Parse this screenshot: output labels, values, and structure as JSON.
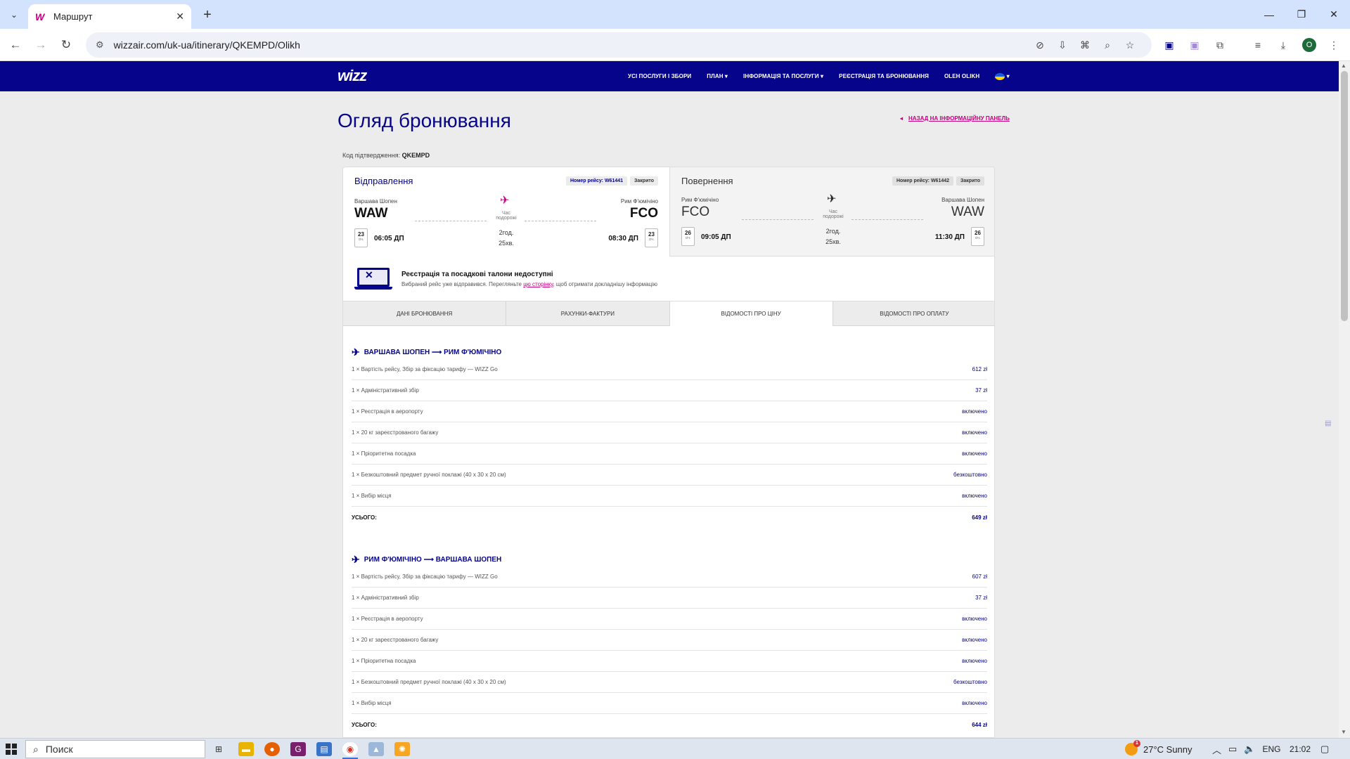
{
  "browser": {
    "tab_title": "Маршрут",
    "url": "wizzair.com/uk-ua/itinerary/QKEMPD/Olikh",
    "profile_initial": "O"
  },
  "site": {
    "logo": "wizz",
    "nav": [
      "УСІ ПОСЛУГИ І ЗБОРИ",
      "ПЛАН",
      "ІНФОРМАЦІЯ ТА ПОСЛУГИ",
      "РЕЄСТРАЦІЯ ТА БРОНЮВАННЯ",
      "OLEH OLIKH"
    ],
    "page_title": "Огляд бронювання",
    "back_link": "НАЗАД НА ІНФОРМАЦІЙНУ ПАНЕЛЬ",
    "confirmation_label": "Код підтвердження:",
    "confirmation_code": "QKEMPD"
  },
  "outbound": {
    "title": "Відправлення",
    "flight_no": "Номер рейсу: W61441",
    "status": "Закрито",
    "from_city": "Варшава Шопен",
    "from_code": "WAW",
    "to_city": "Рим Ф'юмічіно",
    "to_code": "FCO",
    "dep_day": "23",
    "dep_month": "січ.",
    "dep_time": "06:05 ДП",
    "arr_day": "23",
    "arr_month": "січ.",
    "arr_time": "08:30 ДП",
    "duration_label": "Час подорожі",
    "duration_h": "2год.",
    "duration_m": "25хв."
  },
  "return": {
    "title": "Повернення",
    "flight_no": "Номер рейсу: W61442",
    "status": "Закрито",
    "from_city": "Рим Ф'юмічіно",
    "from_code": "FCO",
    "to_city": "Варшава Шопен",
    "to_code": "WAW",
    "dep_day": "26",
    "dep_month": "січ.",
    "dep_time": "09:05 ДП",
    "arr_day": "26",
    "arr_month": "січ.",
    "arr_time": "11:30 ДП",
    "duration_label": "Час подорожі",
    "duration_h": "2год.",
    "duration_m": "25хв."
  },
  "notice": {
    "title": "Реєстрація та посадкові талони недоступні",
    "text_before": "Вибраний рейс уже відправився. Перегляньте ",
    "link": "цю сторінку",
    "text_after": ", щоб отримати докладнішу інформацію"
  },
  "tabs": [
    "ДАНІ БРОНЮВАННЯ",
    "РАХУНКИ-ФАКТУРИ",
    "ВІДОМОСТІ ПРО ЦІНУ",
    "ВІДОМОСТІ ПРО ОПЛАТУ"
  ],
  "price": {
    "outbound": {
      "route_from": "ВАРШАВА ШОПЕН",
      "route_arrow": "⟶",
      "route_to": "РИМ Ф'ЮМІЧІНО",
      "rows": [
        {
          "label": "1 × Вартість рейсу, Збір за фіксацію тарифу — WIZZ Go",
          "value": "612 zł"
        },
        {
          "label": "1 × Адміністративний збір",
          "value": "37 zł"
        },
        {
          "label": "1 × Реєстрація в аеропорту",
          "value": "включено"
        },
        {
          "label": "1 × 20 кг зареєстрованого багажу",
          "value": "включено"
        },
        {
          "label": "1 × Пріоритетна посадка",
          "value": "включено"
        },
        {
          "label": "1 × Безкоштовний предмет ручної поклажі (40 x 30 x 20 см)",
          "value": "безкоштовно"
        },
        {
          "label": "1 × Вибір місця",
          "value": "включено"
        }
      ],
      "total_label": "УСЬОГО:",
      "total_value": "649 zł"
    },
    "return": {
      "route_from": "РИМ Ф'ЮМІЧІНО",
      "route_arrow": "⟶",
      "route_to": "ВАРШАВА ШОПЕН",
      "rows": [
        {
          "label": "1 × Вартість рейсу, Збір за фіксацію тарифу — WIZZ Go",
          "value": "607 zł"
        },
        {
          "label": "1 × Адміністративний збір",
          "value": "37 zł"
        },
        {
          "label": "1 × Реєстрація в аеропорту",
          "value": "включено"
        },
        {
          "label": "1 × 20 кг зареєстрованого багажу",
          "value": "включено"
        },
        {
          "label": "1 × Пріоритетна посадка",
          "value": "включено"
        },
        {
          "label": "1 × Безкоштовний предмет ручної поклажі (40 x 30 x 20 см)",
          "value": "безкоштовно"
        },
        {
          "label": "1 × Вибір місця",
          "value": "включено"
        }
      ],
      "total_label": "УСЬОГО:",
      "total_value": "644 zł"
    }
  },
  "taskbar": {
    "search_placeholder": "Поиск",
    "weather": "27°C  Sunny",
    "weather_badge": "1",
    "lang": "ENG",
    "time": "21:02"
  },
  "colors": {
    "brand_navy": "#06048a",
    "brand_magenta": "#c6007e"
  }
}
